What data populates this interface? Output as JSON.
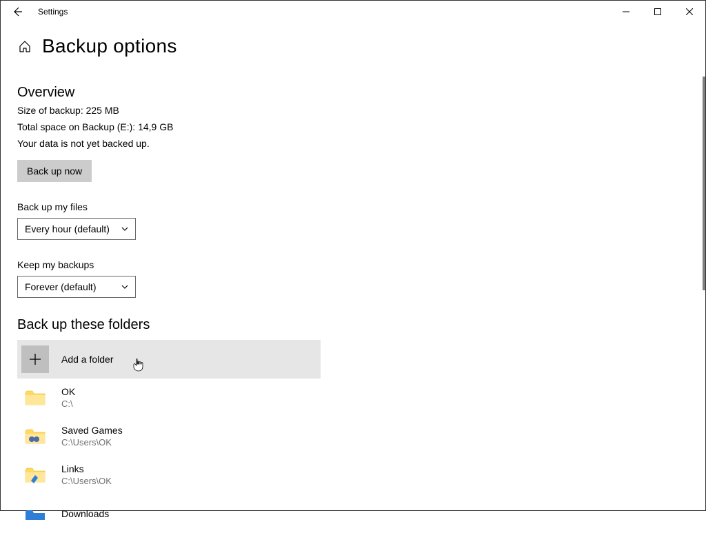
{
  "window": {
    "app_title": "Settings"
  },
  "page": {
    "title": "Backup options"
  },
  "overview": {
    "heading": "Overview",
    "size_line": "Size of backup: 225 MB",
    "space_line": "Total space on Backup (E:): 14,9 GB",
    "status_line": "Your data is not yet backed up.",
    "backup_now": "Back up now"
  },
  "schedule": {
    "label": "Back up my files",
    "value": "Every hour (default)"
  },
  "retention": {
    "label": "Keep my backups",
    "value": "Forever (default)"
  },
  "folders": {
    "heading": "Back up these folders",
    "add_label": "Add a folder",
    "items": [
      {
        "name": "OK",
        "path": "C:\\"
      },
      {
        "name": "Saved Games",
        "path": "C:\\Users\\OK"
      },
      {
        "name": "Links",
        "path": "C:\\Users\\OK"
      },
      {
        "name": "Downloads",
        "path": ""
      }
    ]
  }
}
